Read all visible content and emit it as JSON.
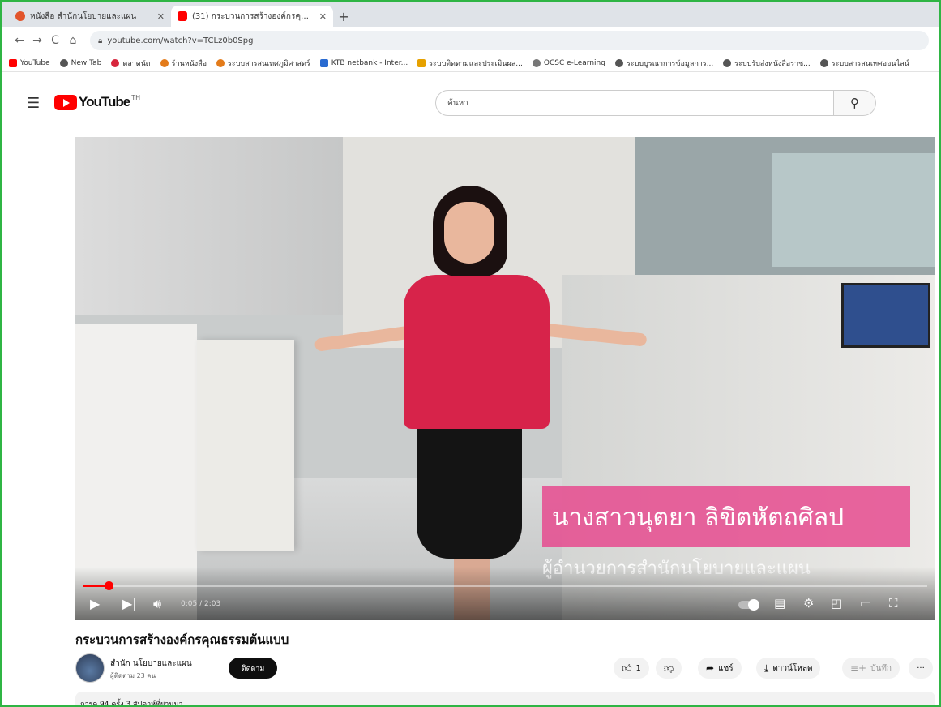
{
  "browser": {
    "tabs": [
      {
        "title": "หนังสือ สำนักนโยบายและแผน",
        "active": false,
        "favicon_color": "#e2542b"
      },
      {
        "title": "(31) กระบวนการสร้างองค์กรคุณธรรม...",
        "active": true,
        "favicon_color": "#ff0000"
      }
    ],
    "new_tab_icon": "plus-icon",
    "url": "youtube.com/watch?v=TCLz0b0Spg",
    "bookmarks": [
      {
        "label": "YouTube",
        "color": "#ff0000"
      },
      {
        "label": "New Tab",
        "color": "#555555"
      },
      {
        "label": "ตลาดนัด",
        "color": "#d7263d"
      },
      {
        "label": "ร้านหนังสือ",
        "color": "#e37b1a"
      },
      {
        "label": "ระบบสารสนเทศภูมิศาสตร์",
        "color": "#e37b1a"
      },
      {
        "label": "KTB netbank - Inter...",
        "color": "#2a6bd1"
      },
      {
        "label": "ระบบติดตามและประเมินผล...",
        "color": "#e6a100"
      },
      {
        "label": "OCSC e-Learning",
        "color": "#777777"
      },
      {
        "label": "ระบบบูรณาการข้อมูลการ...",
        "color": "#555555"
      },
      {
        "label": "ระบบรับส่งหนังสือราช...",
        "color": "#555555"
      },
      {
        "label": "ระบบสารสนเทศออนไลน์",
        "color": "#555555"
      }
    ]
  },
  "youtube": {
    "logo_text": "YouTube",
    "logo_sup": "TH",
    "search_value": "ค้นหา",
    "video": {
      "lower_third_name": "นางสาวนุตยา ลิขิตหัตถศิลป",
      "lower_third_role": "ผู้อำนวยการสำนักนโยบายและแผน",
      "time_display": "0:05 / 2:03",
      "progress_fraction": 0.03
    },
    "title": "กระบวนการสร้างองค์กรคุณธรรมต้นแบบ",
    "channel": {
      "name": "สำนัก นโยบายและแผน",
      "subscribers": "ผู้ติดตาม 23 คน",
      "subscribe_label": "ติดตาม"
    },
    "actions": {
      "like_count": "1",
      "share_label": "แชร์",
      "download_label": "ดาวน์โหลด",
      "save_label": "บันทึก"
    },
    "description_meta": "การดู 94 ครั้ง  3 สัปดาห์ที่ผ่านมา"
  }
}
